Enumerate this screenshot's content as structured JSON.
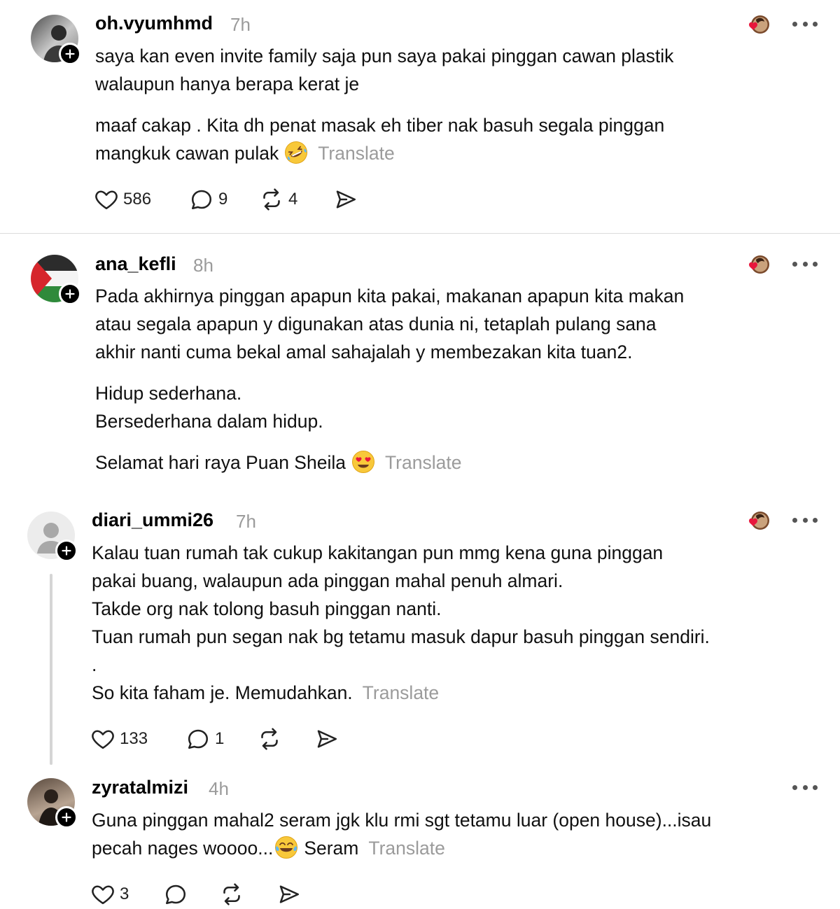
{
  "comments": [
    {
      "username": "oh.vyumhmd",
      "time": "7h",
      "lines_a": [
        "saya kan even invite family saja pun saya pakai pinggan cawan plastik",
        "walaupun hanya berapa kerat je"
      ],
      "lines_b": [
        "maaf cakap . Kita dh penat masak eh tiber nak basuh segala pinggan",
        "mangkuk cawan pulak"
      ],
      "emoji": "rofl-emoji",
      "translate": "Translate",
      "likes": "586",
      "replies": "9",
      "reposts": "4"
    },
    {
      "username": "ana_kefli",
      "time": "8h",
      "lines_a": [
        "Pada akhirnya pinggan apapun kita pakai, makanan apapun kita makan",
        "atau segala apapun y digunakan atas dunia ni, tetaplah pulang sana",
        "akhir nanti cuma bekal amal sahajalah y membezakan kita tuan2."
      ],
      "lines_b": [
        "Hidup sederhana.",
        "Bersederhana dalam hidup."
      ],
      "lines_c": [
        "Selamat hari raya Puan Sheila"
      ],
      "emoji": "heart-eyes-emoji",
      "translate": "Translate"
    },
    {
      "username": "diari_ummi26",
      "time": "7h",
      "lines_a": [
        "Kalau tuan rumah tak cukup kakitangan pun mmg kena guna pinggan",
        "pakai buang, walaupun ada pinggan mahal penuh almari.",
        "Takde org nak tolong basuh pinggan nanti.",
        "Tuan rumah pun segan nak bg tetamu masuk dapur basuh pinggan sendiri.",
        ".",
        "So kita faham je. Memudahkan."
      ],
      "translate": "Translate",
      "likes": "133",
      "replies": "1"
    },
    {
      "username": "zyratalmizi",
      "time": "4h",
      "lines_a": [
        "Guna pinggan mahal2 seram jgk klu rmi sgt tetamu luar (open house)...isau",
        "pecah nages woooo..."
      ],
      "after_emoji": "Seram",
      "emoji": "laughing-tears-emoji",
      "translate": "Translate",
      "likes": "3"
    }
  ],
  "colors": {
    "muted": "#9b9b9b",
    "heart": "#e8173c",
    "divider": "#dcdcdc"
  }
}
